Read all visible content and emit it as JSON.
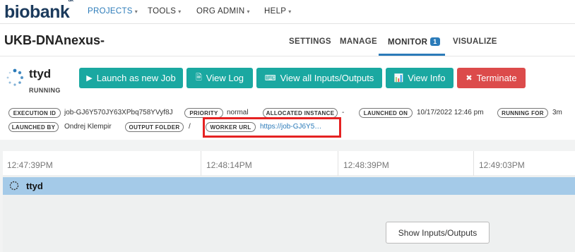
{
  "brand": {
    "logo_text": "biobank",
    "logo_sup": "uk"
  },
  "topnav": {
    "items": [
      {
        "label": "PROJECTS",
        "active": true
      },
      {
        "label": "TOOLS"
      },
      {
        "label": "ORG ADMIN"
      },
      {
        "label": "HELP"
      }
    ]
  },
  "project": {
    "name": "UKB-DNAnexus-",
    "tabs": [
      {
        "label": "SETTINGS"
      },
      {
        "label": "MANAGE"
      },
      {
        "label": "MONITOR",
        "badge": "1",
        "active": true
      },
      {
        "label": "VISUALIZE"
      }
    ]
  },
  "job": {
    "name": "ttyd",
    "state": "RUNNING",
    "actions": {
      "launch": "Launch as new Job",
      "view_log": "View Log",
      "view_io": "View all Inputs/Outputs",
      "view_info": "View Info",
      "terminate": "Terminate"
    },
    "info": {
      "execution_id_label": "EXECUTION ID",
      "execution_id": "job-GJ6Y570JY63XPbq758YVyf8J",
      "priority_label": "PRIORITY",
      "priority": "normal",
      "allocated_instance_label": "ALLOCATED INSTANCE",
      "allocated_instance": "-",
      "launched_on_label": "LAUNCHED ON",
      "launched_on": "10/17/2022 12:46 pm",
      "running_for_label": "RUNNING FOR",
      "running_for": "3m",
      "launched_by_label": "LAUNCHED BY",
      "launched_by": "Ondrej Klempir",
      "output_folder_label": "OUTPUT FOLDER",
      "output_folder": "/",
      "worker_url_label": "WORKER URL",
      "worker_url": "https://job-GJ6Y5…"
    }
  },
  "timeline": {
    "times": [
      "12:47:39PM",
      "12:48:14PM",
      "12:48:39PM",
      "12:49:03PM"
    ],
    "bar_label": "ttyd"
  },
  "show_io_button": "Show Inputs/Outputs",
  "colors": {
    "accent": "#2b7bb9",
    "teal": "#1aa8a1",
    "danger": "#dc4b4b",
    "highlight": "#e52222",
    "bar": "#a4cae8"
  }
}
